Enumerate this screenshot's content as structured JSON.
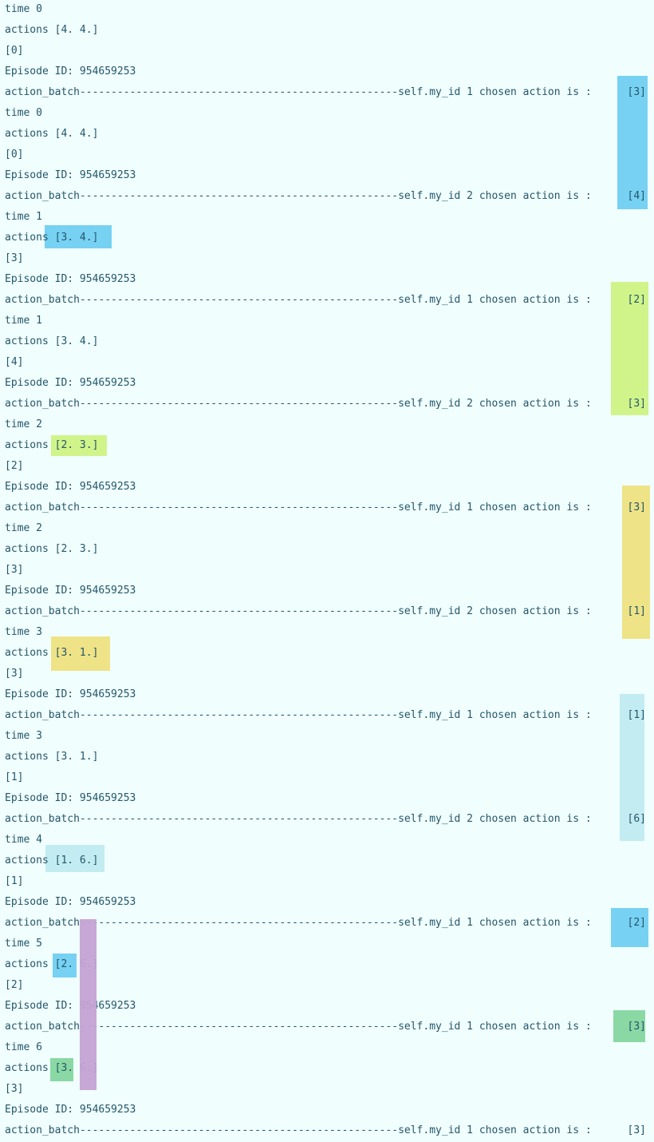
{
  "console": {
    "lines": [
      "time 0",
      "actions [4. 4.]",
      "[0]",
      "Episode ID: 954659253",
      "action_batch---------------------------------------------------self.my_id 1 chosen action is :",
      "time 0",
      "actions [4. 4.]",
      "[0]",
      "Episode ID: 954659253",
      "action_batch---------------------------------------------------self.my_id 2 chosen action is :",
      "time 1",
      "actions [3. 4.]",
      "[3]",
      "Episode ID: 954659253",
      "action_batch---------------------------------------------------self.my_id 1 chosen action is :",
      "time 1",
      "actions [3. 4.]",
      "[4]",
      "Episode ID: 954659253",
      "action_batch---------------------------------------------------self.my_id 2 chosen action is :",
      "time 2",
      "actions [2. 3.]",
      "[2]",
      "Episode ID: 954659253",
      "action_batch---------------------------------------------------self.my_id 1 chosen action is :",
      "time 2",
      "actions [2. 3.]",
      "[3]",
      "Episode ID: 954659253",
      "action_batch---------------------------------------------------self.my_id 2 chosen action is :",
      "time 3",
      "actions [3. 1.]",
      "[3]",
      "Episode ID: 954659253",
      "action_batch---------------------------------------------------self.my_id 1 chosen action is :",
      "time 3",
      "actions [3. 1.]",
      "[1]",
      "Episode ID: 954659253",
      "action_batch---------------------------------------------------self.my_id 2 chosen action is :",
      "time 4",
      "actions [1. 6.]",
      "[1]",
      "Episode ID: 954659253",
      "action_batch---------------------------------------------------self.my_id 1 chosen action is :",
      "time 5",
      "actions [2. 6.]",
      "[2]",
      "Episode ID: 954659253",
      "action_batch---------------------------------------------------self.my_id 1 chosen action is :",
      "time 6",
      "actions [3. 6.]",
      "[3]",
      "Episode ID: 954659253",
      "action_batch---------------------------------------------------self.my_id 1 chosen action is :"
    ],
    "chosen_values": {
      "4": "[3]",
      "9": "[4]",
      "14": "[2]",
      "19": "[3]",
      "24": "[3]",
      "29": "[1]",
      "34": "[1]",
      "39": "[6]",
      "44": "[2]",
      "49": "[3]",
      "54": "[3]"
    }
  },
  "colors": {
    "background": "#f0fefe",
    "text": "#24566a",
    "highlight_blue": "#77d1f3",
    "highlight_lime": "#d1f48a",
    "highlight_yellow": "#eee386",
    "highlight_lightblue": "#c2ecf2",
    "highlight_green": "#8ad8a4",
    "highlight_purple": "#c4a2d4"
  }
}
